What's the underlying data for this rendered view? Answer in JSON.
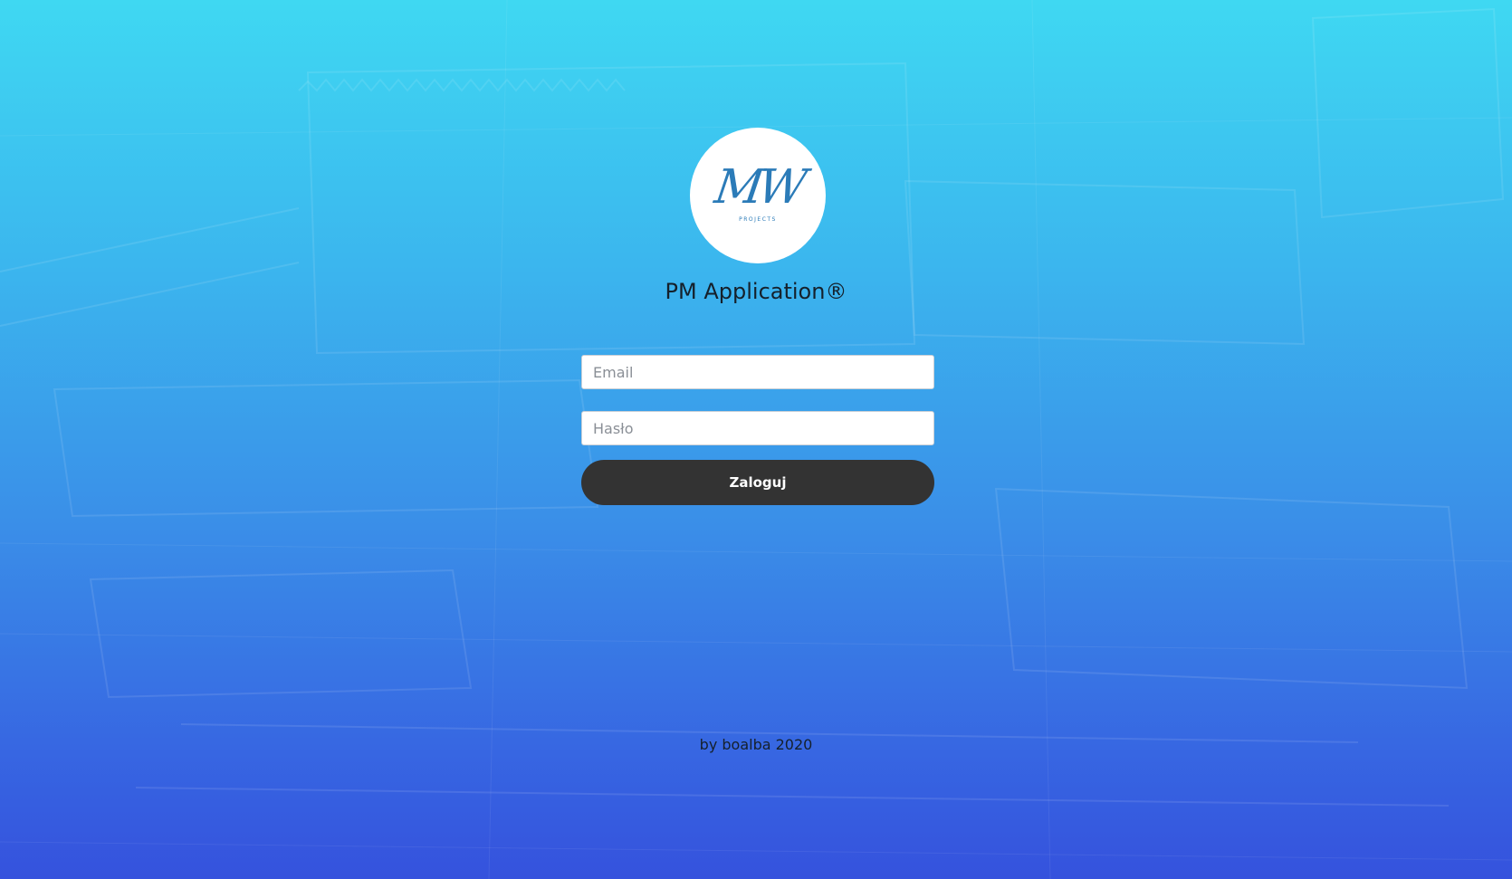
{
  "app": {
    "title": "PM Application®",
    "logo": {
      "mark": "MW",
      "subtitle": "PROJECTS"
    }
  },
  "form": {
    "email_placeholder": "Email",
    "password_placeholder": "Hasło",
    "login_label": "Zaloguj"
  },
  "footer": {
    "text": "by boalba 2020"
  },
  "colors": {
    "gradient_top": "#3fd8f2",
    "gradient_bottom": "#3552dd",
    "button": "#333333",
    "logo_accent": "#2b7bb8"
  }
}
